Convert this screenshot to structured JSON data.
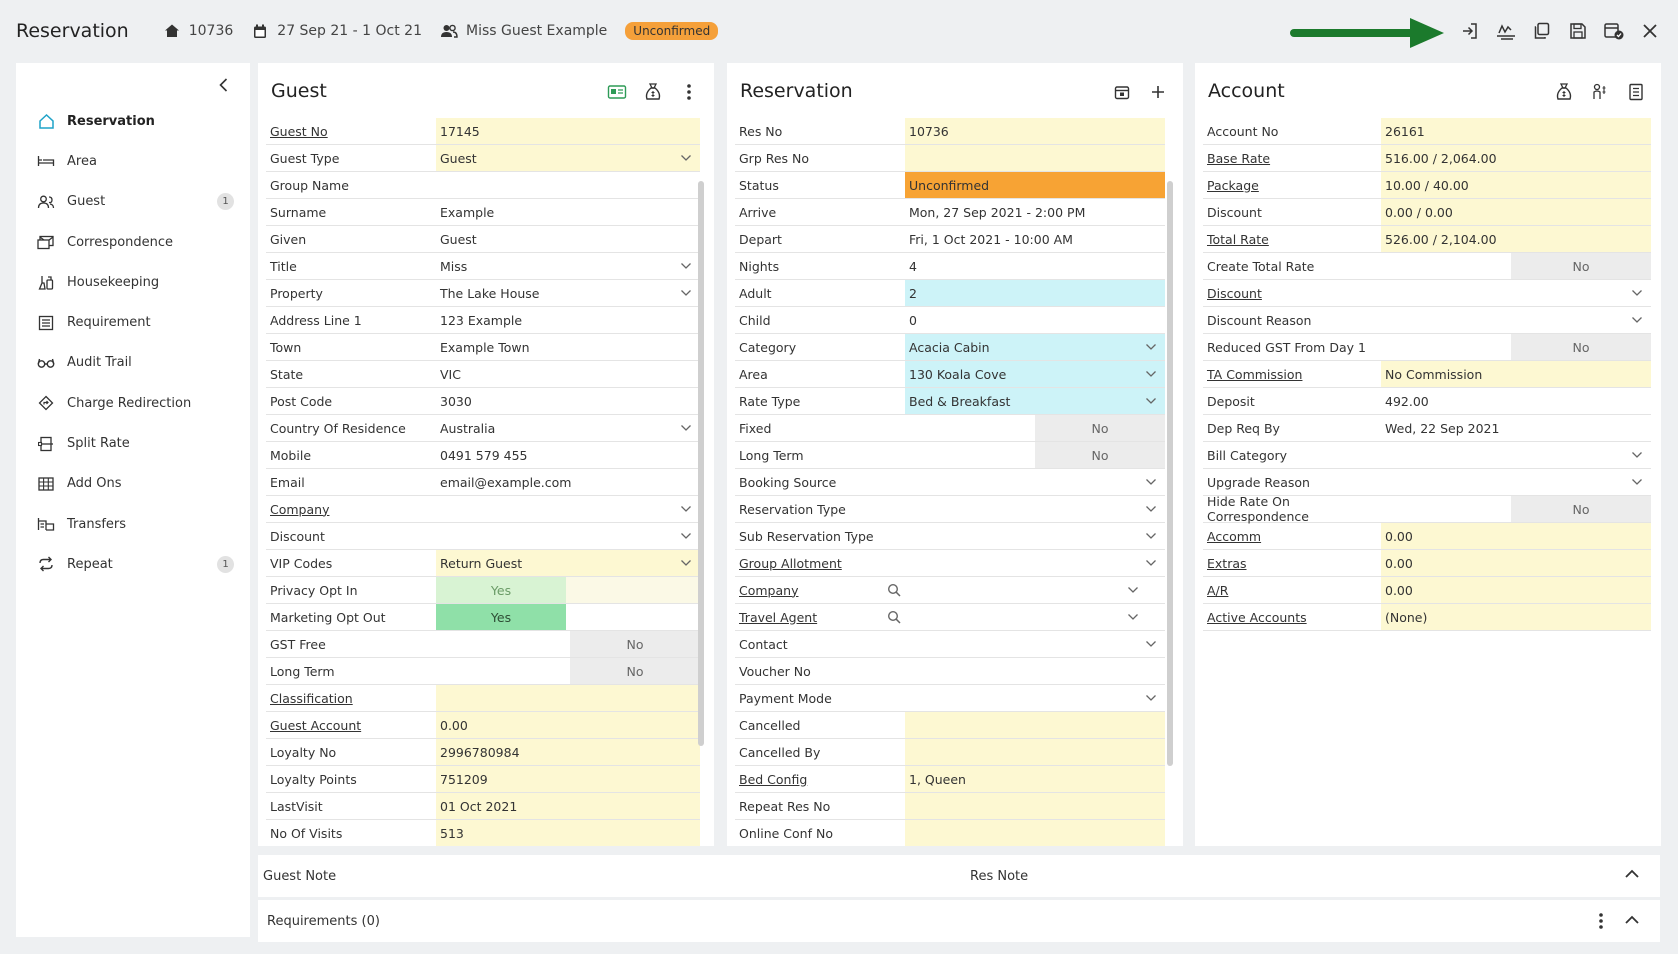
{
  "header": {
    "title": "Reservation",
    "res_no": "10736",
    "dates": "27 Sep 21  -  1 Oct 21",
    "guest_name": "Miss Guest Example",
    "status_badge": "Unconfirmed",
    "colors": {
      "badge": "#f5a03a",
      "arrow": "#1b7a2c"
    }
  },
  "sidebar": {
    "items": [
      {
        "label": "Reservation",
        "icon": "home-icon",
        "active": true
      },
      {
        "label": "Area",
        "icon": "bed-icon"
      },
      {
        "label": "Guest",
        "icon": "guests-icon",
        "count": "1"
      },
      {
        "label": "Correspondence",
        "icon": "mail-icon"
      },
      {
        "label": "Housekeeping",
        "icon": "housekeeping-icon"
      },
      {
        "label": "Requirement",
        "icon": "list-icon"
      },
      {
        "label": "Audit Trail",
        "icon": "glasses-icon"
      },
      {
        "label": "Charge Redirection",
        "icon": "redirect-icon"
      },
      {
        "label": "Split Rate",
        "icon": "split-icon"
      },
      {
        "label": "Add Ons",
        "icon": "grid-icon"
      },
      {
        "label": "Transfers",
        "icon": "bus-icon"
      },
      {
        "label": "Repeat",
        "icon": "repeat-icon",
        "count": "1"
      }
    ]
  },
  "guest": {
    "title": "Guest",
    "rows": [
      {
        "label": "Guest No",
        "value": "17145"
      },
      {
        "label": "Guest Type",
        "value": "Guest"
      },
      {
        "label": "Group Name",
        "value": ""
      },
      {
        "label": "Surname",
        "value": "Example"
      },
      {
        "label": "Given",
        "value": "Guest"
      },
      {
        "label": "Title",
        "value": "Miss"
      },
      {
        "label": "Property",
        "value": "The Lake House"
      },
      {
        "label": "Address Line 1",
        "value": "123 Example"
      },
      {
        "label": "Town",
        "value": "Example Town"
      },
      {
        "label": "State",
        "value": "VIC"
      },
      {
        "label": "Post Code",
        "value": "3030"
      },
      {
        "label": "Country Of Residence",
        "value": "Australia"
      },
      {
        "label": "Mobile",
        "value": "0491 579 455"
      },
      {
        "label": "Email",
        "value": "email@example.com"
      },
      {
        "label": "Company",
        "value": ""
      },
      {
        "label": "Discount",
        "value": ""
      },
      {
        "label": "VIP Codes",
        "value": "Return Guest"
      },
      {
        "label": "Privacy Opt In",
        "value": "Yes"
      },
      {
        "label": "Marketing Opt Out",
        "value": "Yes"
      },
      {
        "label": "GST Free",
        "value": "No"
      },
      {
        "label": "Long Term",
        "value": "No"
      },
      {
        "label": "Classification",
        "value": ""
      },
      {
        "label": "Guest Account",
        "value": "0.00"
      },
      {
        "label": "Loyalty No",
        "value": "2996780984"
      },
      {
        "label": "Loyalty Points",
        "value": "751209"
      },
      {
        "label": "LastVisit",
        "value": "01 Oct 2021"
      },
      {
        "label": "No Of Visits",
        "value": "513"
      }
    ]
  },
  "reservation": {
    "title": "Reservation",
    "rows": [
      {
        "label": "Res No",
        "value": "10736"
      },
      {
        "label": "Grp Res No",
        "value": ""
      },
      {
        "label": "Status",
        "value": "Unconfirmed"
      },
      {
        "label": "Arrive",
        "value": "Mon, 27 Sep 2021 - 2:00 PM"
      },
      {
        "label": "Depart",
        "value": "Fri, 1 Oct 2021 - 10:00 AM"
      },
      {
        "label": "Nights",
        "value": "4"
      },
      {
        "label": "Adult",
        "value": "2"
      },
      {
        "label": "Child",
        "value": "0"
      },
      {
        "label": "Category",
        "value": "Acacia Cabin"
      },
      {
        "label": "Area",
        "value": "130 Koala Cove"
      },
      {
        "label": "Rate Type",
        "value": "Bed & Breakfast"
      },
      {
        "label": "Fixed",
        "value": "No"
      },
      {
        "label": "Long Term",
        "value": "No"
      },
      {
        "label": "Booking Source",
        "value": ""
      },
      {
        "label": "Reservation Type",
        "value": ""
      },
      {
        "label": "Sub Reservation Type",
        "value": ""
      },
      {
        "label": "Group Allotment",
        "value": ""
      },
      {
        "label": "Company",
        "value": ""
      },
      {
        "label": "Travel Agent",
        "value": ""
      },
      {
        "label": "Contact",
        "value": ""
      },
      {
        "label": "Voucher No",
        "value": ""
      },
      {
        "label": "Payment Mode",
        "value": ""
      },
      {
        "label": "Cancelled",
        "value": ""
      },
      {
        "label": "Cancelled By",
        "value": ""
      },
      {
        "label": "Bed Config",
        "value": "1, Queen"
      },
      {
        "label": "Repeat Res No",
        "value": ""
      },
      {
        "label": "Online Conf No",
        "value": ""
      }
    ]
  },
  "account": {
    "title": "Account",
    "rows": [
      {
        "label": "Account No",
        "value": "26161"
      },
      {
        "label": "Base Rate",
        "value": "516.00 / 2,064.00"
      },
      {
        "label": "Package",
        "value": "10.00 / 40.00"
      },
      {
        "label": "Discount",
        "value": "0.00 / 0.00"
      },
      {
        "label": "Total Rate",
        "value": "526.00 / 2,104.00"
      },
      {
        "label": "Create Total Rate",
        "value": "No"
      },
      {
        "label": "Discount",
        "value": ""
      },
      {
        "label": "Discount Reason",
        "value": ""
      },
      {
        "label": "Reduced GST From Day 1",
        "value": "No"
      },
      {
        "label": "TA Commission",
        "value": "No Commission"
      },
      {
        "label": "Deposit",
        "value": "492.00"
      },
      {
        "label": "Dep Req By",
        "value": "Wed, 22 Sep 2021"
      },
      {
        "label": "Bill Category",
        "value": ""
      },
      {
        "label": "Upgrade Reason",
        "value": ""
      },
      {
        "label": "Hide Rate On Correspondence",
        "value": "No"
      },
      {
        "label": "Accomm",
        "value": "0.00"
      },
      {
        "label": "Extras",
        "value": "0.00"
      },
      {
        "label": "A/R",
        "value": "0.00"
      },
      {
        "label": "Active Accounts",
        "value": "(None)"
      }
    ]
  },
  "notes": {
    "guest_note": "Guest Note",
    "res_note": "Res Note"
  },
  "requirements": {
    "label": "Requirements (0)"
  }
}
